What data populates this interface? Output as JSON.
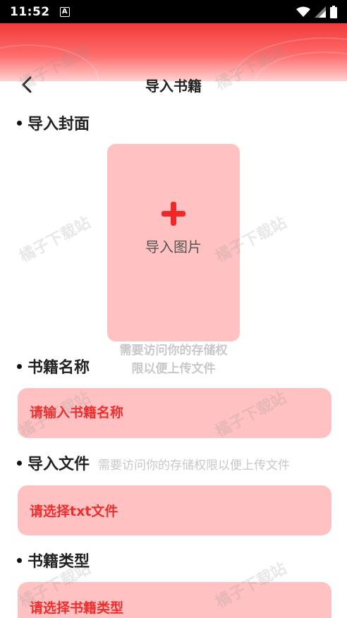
{
  "status_bar": {
    "time": "11:52",
    "notif_badge": "A"
  },
  "header": {
    "title": "导入书籍"
  },
  "cover": {
    "label": "导入封面",
    "button_label": "导入图片",
    "hint_line1": "需要访问你的存储权",
    "hint_line2": "限以便上传文件"
  },
  "book_name": {
    "label": "书籍名称",
    "placeholder": "请输入书籍名称"
  },
  "file": {
    "label": "导入文件",
    "hint": "需要访问你的存储权限以便上传文件",
    "select_label": "请选择txt文件"
  },
  "book_type": {
    "label": "书籍类型",
    "select_label": "请选择书籍类型"
  },
  "watermark": "橘子下载站",
  "colors": {
    "accent": "#ee2e2e",
    "field_bg": "#ffc1c1",
    "header": "#f23a3a"
  }
}
